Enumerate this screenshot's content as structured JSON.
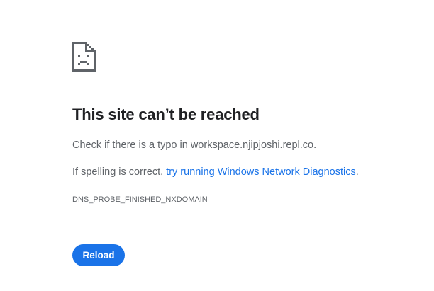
{
  "error": {
    "icon": "sad-page-icon",
    "title": "This site can’t be reached",
    "typo_prefix": "Check if there is a typo in ",
    "domain": "workspace.njipjoshi.repl.co",
    "typo_suffix": ".",
    "spelling_prefix": "If spelling is correct, ",
    "diagnostics_link": "try running Windows Network Diagnostics",
    "spelling_suffix": ".",
    "code": "DNS_PROBE_FINISHED_NXDOMAIN"
  },
  "actions": {
    "reload_label": "Reload"
  },
  "colors": {
    "accent": "#1a73e8",
    "title": "#202124",
    "text": "#5f6368",
    "icon": "#5f6368"
  }
}
